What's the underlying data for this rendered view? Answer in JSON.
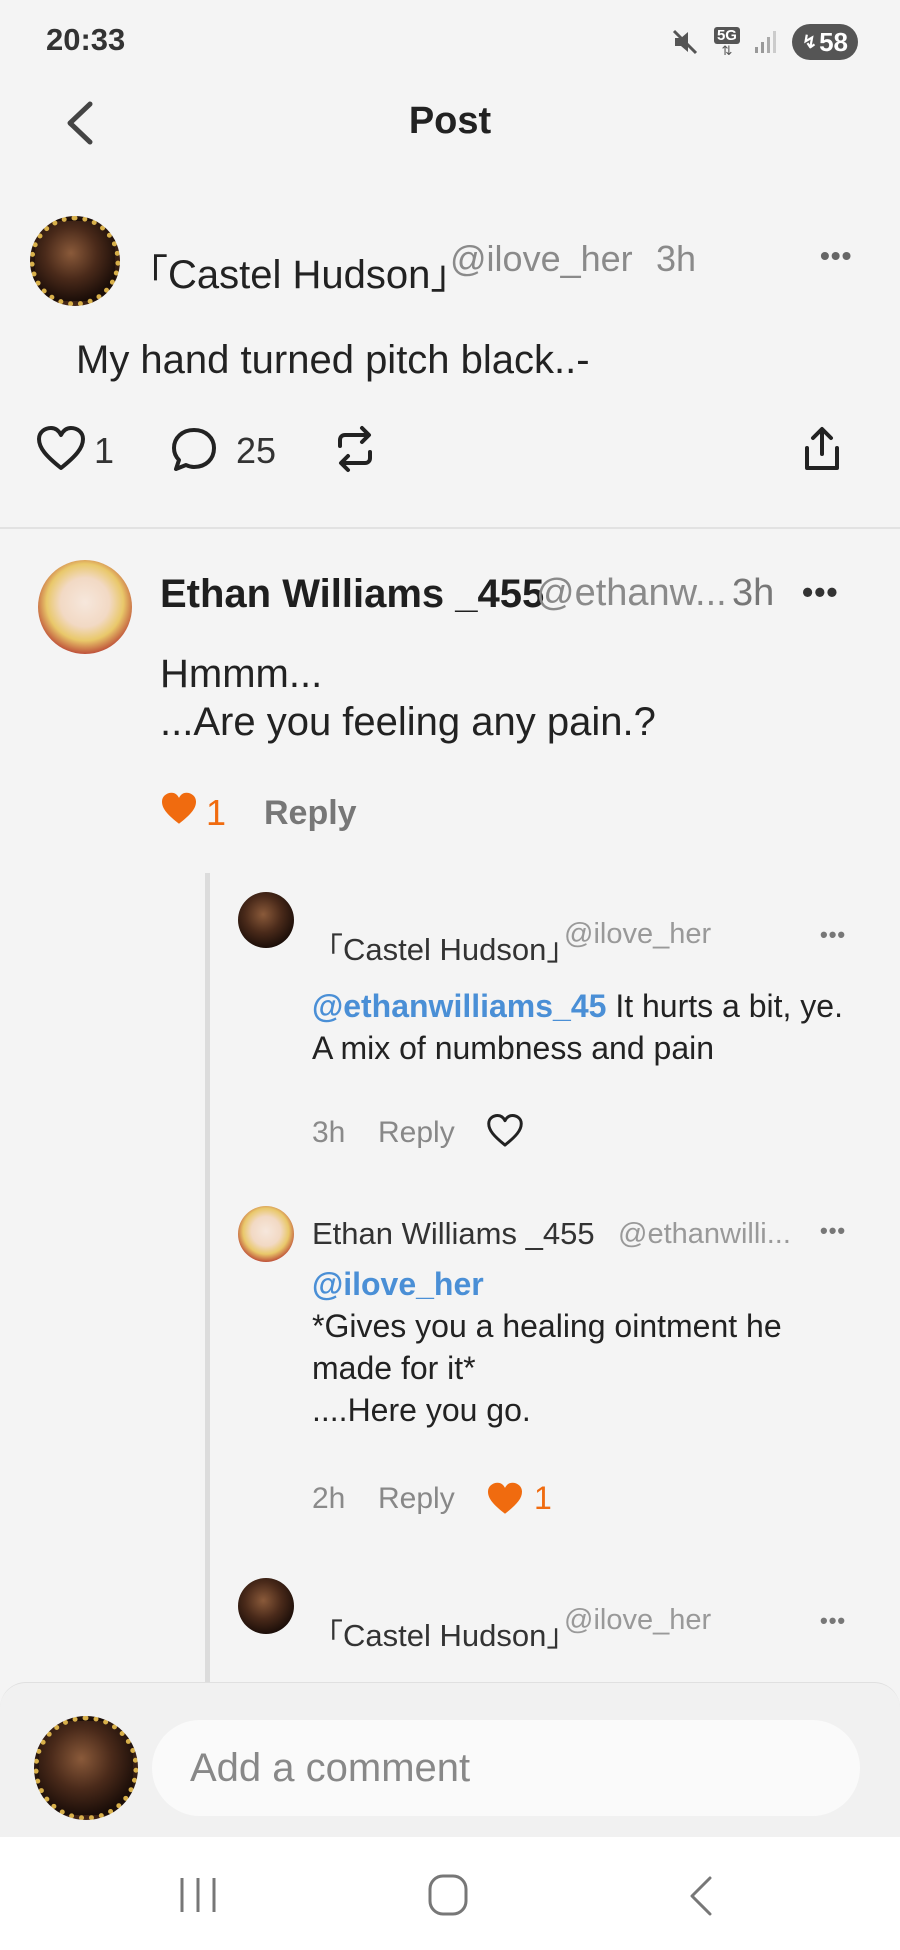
{
  "status_bar": {
    "time": "20:33",
    "network": "5G",
    "battery": "58",
    "icons": [
      "mute-icon",
      "signal-5g-icon",
      "signal-bars-icon",
      "battery-icon"
    ]
  },
  "header": {
    "title": "Post",
    "back_icon": "chevron-left-icon"
  },
  "post": {
    "author_name": "「Castel Hudson」",
    "handle": "@ilove_her",
    "time": "3h",
    "body": "My hand turned pitch black..-",
    "likes": "1",
    "comments": "25"
  },
  "comments": [
    {
      "author_name": "Ethan Williams _455",
      "handle": "@ethanw...",
      "time": "3h",
      "line1": "Hmmm...",
      "line2": "...Are you feeling any pain.?",
      "likes": "1",
      "reply_label": "Reply",
      "replies": [
        {
          "author_name": "「Castel Hudson」",
          "handle": "@ilove_her",
          "mention": "@ethanwilliams_45",
          "text_rest": " It hurts a bit, ye.",
          "line2": "A mix of numbness and pain",
          "time": "3h",
          "reply_label": "Reply"
        },
        {
          "author_name": "Ethan Williams _455",
          "handle": "@ethanwilli...",
          "mention": "@ilove_her",
          "line1": "*Gives you a healing ointment he",
          "line2": "made for it*",
          "line3": "....Here you go.",
          "time": "2h",
          "reply_label": "Reply",
          "likes": "1"
        },
        {
          "author_name": "「Castel Hudson」",
          "handle": "@ilove_her"
        }
      ]
    }
  ],
  "comment_bar": {
    "placeholder": "Add a comment"
  },
  "colors": {
    "accent_orange": "#f06b0f",
    "mention_blue": "#4a8fd6"
  }
}
